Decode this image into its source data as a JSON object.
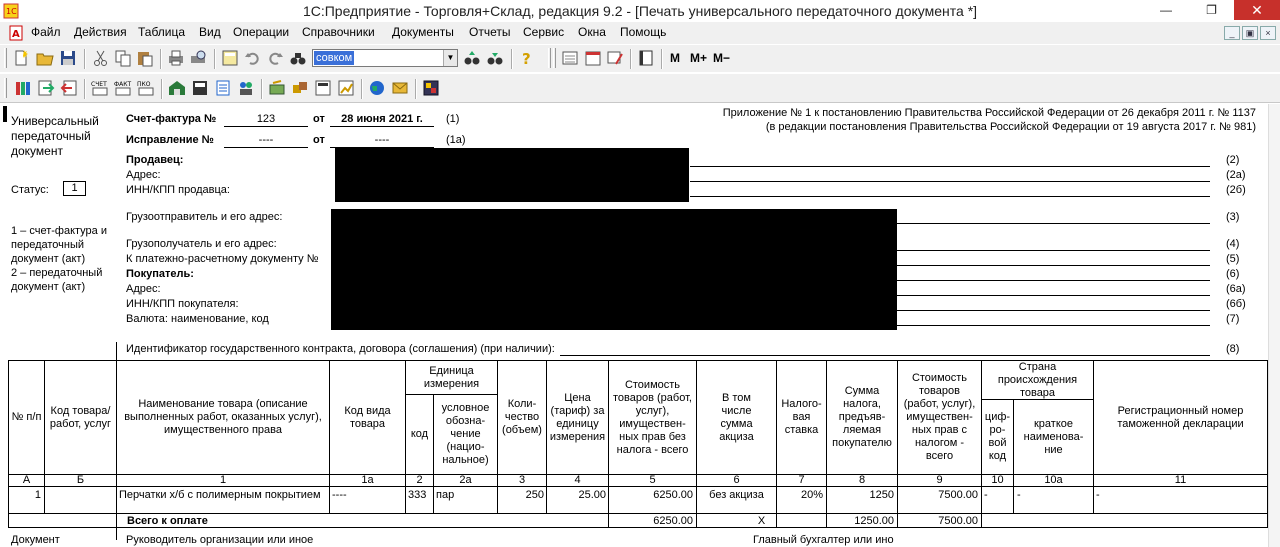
{
  "window": {
    "title": "1С:Предприятие - Торговля+Склад, редакция 9.2 - [Печать универсального передаточного документа  *]"
  },
  "menu": [
    "Файл",
    "Действия",
    "Таблица",
    "Вид",
    "Операции",
    "Справочники",
    "Документы",
    "Отчеты",
    "Сервис",
    "Окна",
    "Помощь"
  ],
  "toolbar": {
    "combo_value": "совком",
    "m_label": "M",
    "mplus_label": "M+",
    "mminus_label": "M−"
  },
  "doc": {
    "upd_title_1": "Универсальный",
    "upd_title_2": "передаточный",
    "upd_title_3": "документ",
    "status_label": "Статус:",
    "status_value": "1",
    "status_note_1": "1 – счет-фактура и",
    "status_note_2": "передаточный",
    "status_note_3": "документ (акт)",
    "status_note_4": "2 – передаточный",
    "status_note_5": "документ (акт)",
    "invoice_label": "Счет-фактура №",
    "invoice_number": "123",
    "from_label": "от",
    "invoice_date": "28 июня 2021 г.",
    "invoice_ref": "(1)",
    "correction_label": "Исправление №",
    "correction_number": "----",
    "correction_from": "от",
    "correction_date": "----",
    "correction_ref": "(1а)",
    "appendix_1": "Приложение № 1 к постановлению Правительства Российской Федерации от 26 декабря 2011 г. № 1137",
    "appendix_2": "(в редакции постановления Правительства Российской Федерации от 19 августа 2017 г. № 981)",
    "seller_label": "Продавец:",
    "address_label": "Адрес:",
    "seller_inn_label": "ИНН/КПП продавца:",
    "shipper_label": "Грузоотправитель и его адрес:",
    "consignee_label": "Грузополучатель и его адрес:",
    "payment_doc_label": "К платежно-расчетному документу №",
    "buyer_label": "Покупатель:",
    "buyer_address_label": "Адрес:",
    "buyer_inn_label": "ИНН/КПП покупателя:",
    "currency_label": "Валюта: наименование, код",
    "contract_label": "Идентификатор государственного контракта, договора (соглашения) (при наличии):",
    "ref_2": "(2)",
    "ref_2a": "(2а)",
    "ref_2b": "(2б)",
    "ref_3": "(3)",
    "ref_4": "(4)",
    "ref_5": "(5)",
    "ref_6": "(6)",
    "ref_6a": "(6а)",
    "ref_6b": "(6б)",
    "ref_7": "(7)",
    "ref_8": "(8)"
  },
  "table": {
    "headers": {
      "num": "№ п/п",
      "code": "Код товара/ работ, услуг",
      "name": "Наименование товара (описание выполненных работ, оказанных услуг), имущественного права",
      "kind_code": "Код вида товара",
      "unit": "Единица измерения",
      "unit_code": "код",
      "unit_name": "условное обозна-чение (нацио-нальное)",
      "qty": "Коли-чество (объем)",
      "price": "Цена (тариф) за единицу измерения",
      "cost_no_tax": "Стоимость товаров (работ, услуг), имуществен-ных прав без налога - всего",
      "excise": "В том числе сумма акциза",
      "tax_rate": "Налого-вая ставка",
      "tax_sum": "Сумма налога, предъяв-ляемая покупателю",
      "cost_with_tax": "Стоимость товаров (работ, услуг), имуществен-ных прав с налогом - всего",
      "country": "Страна происхождения товара",
      "country_code": "циф-ро-вой код",
      "country_name": "краткое наименова-ние",
      "customs": "Регистрационный номер таможенной декларации"
    },
    "col_index": [
      "А",
      "Б",
      "1",
      "1а",
      "2",
      "2а",
      "3",
      "4",
      "5",
      "6",
      "7",
      "8",
      "9",
      "10",
      "10а",
      "11"
    ],
    "row": {
      "num": "1",
      "code": "",
      "name": "Перчатки х/б с полимерным покрытием",
      "kind_code": "----",
      "unit_code": "333",
      "unit_name": "пар",
      "qty": "250",
      "price": "25.00",
      "cost_no_tax": "6250.00",
      "excise": "без акциза",
      "tax_rate": "20%",
      "tax_sum": "1250",
      "cost_with_tax": "7500.00",
      "country_code": "-",
      "country_name": "-",
      "customs": "-"
    },
    "total": {
      "label": "Всего к оплате",
      "cost_no_tax": "6250.00",
      "excise": "X",
      "tax_sum": "1250.00",
      "cost_with_tax": "7500.00"
    }
  },
  "footer": {
    "doc_label": "Документ",
    "head_label": "Руководитель организации или иное",
    "accountant_label": "Главный бухгалтер или ино"
  }
}
